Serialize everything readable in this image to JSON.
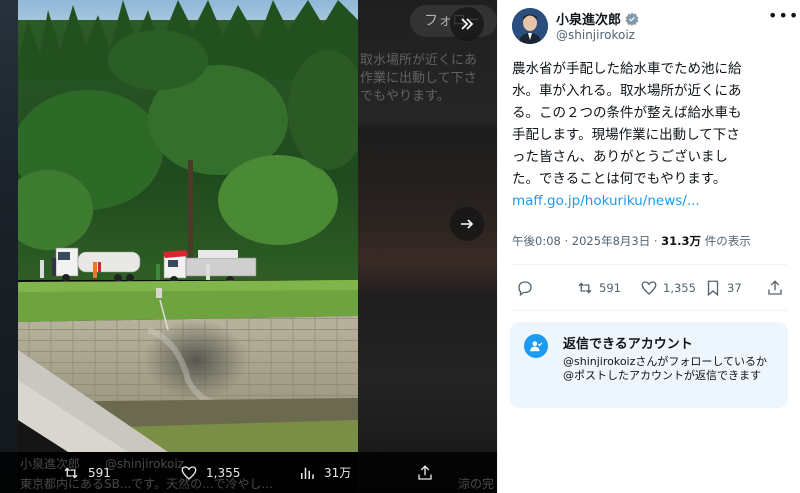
{
  "viewer": {
    "background_text": {
      "right_line1": "取水場所が近くにあ",
      "right_line2": "作業に出動して下さ",
      "right_line3": "でもやります。",
      "bottom_name": "小泉進次郎",
      "bottom_handle": "@shinjirokoiz",
      "bottom_text": "東京都内にあるSB...です。天然の...で冷やし...",
      "bottom_right": "涼の完"
    },
    "follow_label": "フォロー",
    "bottom_bar": {
      "retweets": "591",
      "likes": "1,355",
      "views": "31万"
    }
  },
  "tweet": {
    "author_name": "小泉進次郎",
    "author_handle": "@shinjirokoiz",
    "verified": true,
    "text_lines": [
      "農水省が手配した給水車でため池に給",
      "水。車が入れる。取水場所が近くにあ",
      "る。この２つの条件が整えば給水車も",
      "手配します。現場作業に出動して下さ",
      "った皆さん、ありがとうございまし",
      "た。できることは何でもやります。"
    ],
    "link": "maff.go.jp/hokuriku/news/...",
    "time": "午後0:08",
    "separator": "·",
    "date": "2025年8月3日",
    "views_count": "31.3万",
    "views_label": "件の表示",
    "retweets": "591",
    "likes": "1,355",
    "bookmarks": "37"
  },
  "reply_settings": {
    "title": "返信できるアカウント",
    "body": "@shinjirokoizさんがフォローしているか@ポストしたアカウントが返信できます"
  },
  "colors": {
    "accent": "#1d9bf0",
    "verified": "#829aab",
    "text_secondary": "#536471",
    "reply_box_bg": "#eef6fd"
  }
}
